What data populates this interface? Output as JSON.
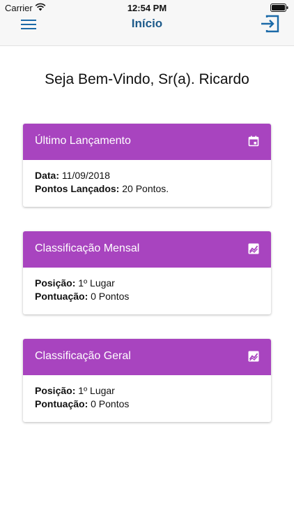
{
  "status": {
    "carrier": "Carrier",
    "time": "12:54 PM"
  },
  "nav": {
    "title": "Início"
  },
  "welcome": "Seja Bem-Vindo, Sr(a). Ricardo",
  "cards": [
    {
      "title": "Último Lançamento",
      "icon": "calendar-event-icon",
      "rows": [
        {
          "label": "Data:",
          "value": "11/09/2018"
        },
        {
          "label": "Pontos Lançados:",
          "value": "20 Pontos."
        }
      ]
    },
    {
      "title": "Classificação Mensal",
      "icon": "trending-chart-icon",
      "rows": [
        {
          "label": "Posição:",
          "value": "1º Lugar"
        },
        {
          "label": "Pontuação:",
          "value": "0 Pontos"
        }
      ]
    },
    {
      "title": "Classificação Geral",
      "icon": "trending-chart-icon",
      "rows": [
        {
          "label": "Posição:",
          "value": "1º Lugar"
        },
        {
          "label": "Pontuação:",
          "value": "0 Pontos"
        }
      ]
    }
  ],
  "colors": {
    "accent": "#a844bf",
    "nav_title": "#1d5a8a",
    "nav_icons": "#1b6aa8"
  }
}
